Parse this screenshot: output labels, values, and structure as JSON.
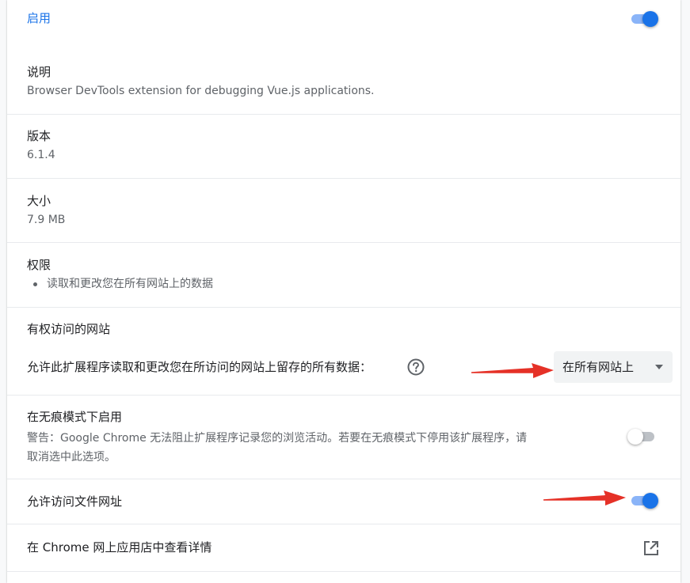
{
  "enabled": {
    "label": "启用",
    "state": "on"
  },
  "description": {
    "title": "说明",
    "text": "Browser DevTools extension for debugging Vue.js applications."
  },
  "version": {
    "title": "版本",
    "value": "6.1.4"
  },
  "size": {
    "title": "大小",
    "value": "7.9 MB"
  },
  "permissions": {
    "title": "权限",
    "items": [
      "读取和更改您在所有网站上的数据"
    ]
  },
  "site_access": {
    "title": "有权访问的网站",
    "label": "允许此扩展程序读取和更改您在所访问的网站上留存的所有数据：",
    "help_icon": "help-circle-icon",
    "selected_option": "在所有网站上"
  },
  "incognito": {
    "title": "在无痕模式下启用",
    "warning_line1": "警告：Google Chrome 无法阻止扩展程序记录您的浏览活动。若要在无痕模式下停用该扩展程序，请",
    "warning_line2": "取消选中此选项。",
    "state": "off"
  },
  "file_urls": {
    "label": "允许访问文件网址",
    "state": "on"
  },
  "webstore": {
    "label": "在 Chrome 网上应用店中查看详情",
    "icon": "open-in-new-icon"
  },
  "colors": {
    "accent": "#1a73e8",
    "arrow": "#e53127"
  }
}
